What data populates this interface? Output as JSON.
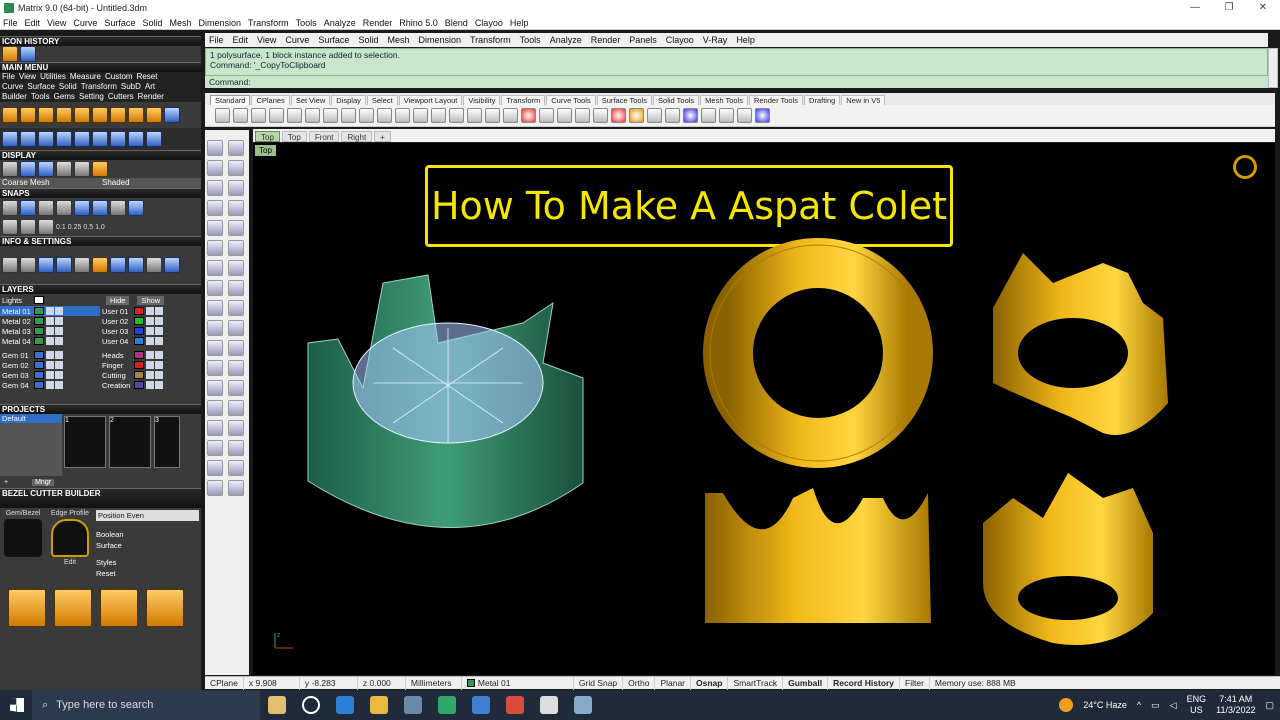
{
  "window": {
    "title": "Matrix 9.0 (64-bit) - Untitled.3dm",
    "controls": [
      "—",
      "❐",
      "✕"
    ]
  },
  "top_menu": [
    "File",
    "Edit",
    "View",
    "Curve",
    "Surface",
    "Solid",
    "Mesh",
    "Dimension",
    "Transform",
    "Tools",
    "Analyze",
    "Render",
    "Rhino 5.0",
    "Blend",
    "Clayoo",
    "Help"
  ],
  "left_panel": {
    "icon_history": "ICON HISTORY",
    "main_menu": "MAIN MENU",
    "main_menu_row1": [
      "File",
      "View",
      "Utilities",
      "Measure",
      "Custom",
      "Reset"
    ],
    "main_menu_row2": [
      "Curve",
      "Surface",
      "Solid",
      "Transform",
      "SubD",
      "Art"
    ],
    "main_menu_row3": [
      "Builder",
      "Tools",
      "Gems",
      "Setting",
      "Cutters",
      "Render"
    ],
    "display": "DISPLAY",
    "display_mode1": "Coarse Mesh",
    "display_mode2": "Shaded",
    "snaps": "SNAPS",
    "snap_values": [
      "0.1",
      "0.25",
      "0.5",
      "1.0"
    ],
    "info_settings": "INFO & SETTINGS",
    "layers": "LAYERS",
    "lights": "Lights",
    "hide": "Hide",
    "show": "Show",
    "layers_left": [
      {
        "name": "Metal 01",
        "color": "#2e9d4b"
      },
      {
        "name": "Metal 02",
        "color": "#2e9d4b"
      },
      {
        "name": "Metal 03",
        "color": "#2e9d4b"
      },
      {
        "name": "Metal 04",
        "color": "#2e9d4b"
      },
      {
        "name": "Gem 01",
        "color": "#3d6fd1"
      },
      {
        "name": "Gem 02",
        "color": "#3d6fd1"
      },
      {
        "name": "Gem 03",
        "color": "#3d6fd1"
      },
      {
        "name": "Gem 04",
        "color": "#3d6fd1"
      }
    ],
    "layers_right": [
      {
        "name": "User 01",
        "color": "#e02020"
      },
      {
        "name": "User 02",
        "color": "#20c020"
      },
      {
        "name": "User 03",
        "color": "#2040e0"
      },
      {
        "name": "User 04",
        "color": "#2080e0"
      },
      {
        "name": "Heads",
        "color": "#b03090"
      },
      {
        "name": "Finger",
        "color": "#d02020"
      },
      {
        "name": "Cutting",
        "color": "#b08040"
      },
      {
        "name": "Creation",
        "color": "#6040a0"
      }
    ],
    "projects": "PROJECTS",
    "projects_default": "Default",
    "project_thumbs": [
      "1",
      "2",
      "3"
    ],
    "mngr": "Mngr",
    "bezel_title": "BEZEL CUTTER BUILDER",
    "gem_bezel": "Gem/Bezel",
    "edge_profile": "Edge Profile",
    "edit": "Edit",
    "position_evenly": "Position Even",
    "boolean": "Boolean",
    "surface": "Surface",
    "styles": "Styles",
    "reset": "Reset"
  },
  "rhino_menu": [
    "File",
    "Edit",
    "View",
    "Curve",
    "Surface",
    "Solid",
    "Mesh",
    "Dimension",
    "Transform",
    "Tools",
    "Analyze",
    "Render",
    "Panels",
    "Clayoo",
    "V-Ray",
    "Help"
  ],
  "command": {
    "line1": "1 polysurface, 1 block instance added to selection.",
    "line2": "Command: '_CopyToClipboard",
    "prompt": "Command:"
  },
  "toolbar_tabs": [
    "Standard",
    "CPlanes",
    "Set View",
    "Display",
    "Select",
    "Viewport Layout",
    "Visibility",
    "Transform",
    "Curve Tools",
    "Surface Tools",
    "Solid Tools",
    "Mesh Tools",
    "Render Tools",
    "Drafting",
    "New in V5"
  ],
  "view_tabs": [
    "Top",
    "Top",
    "Front",
    "Right",
    "+"
  ],
  "viewport": {
    "label": "Top",
    "heading": "How To Make A Aspat Colet"
  },
  "status": {
    "cplane": "CPlane",
    "x": "x 9.908",
    "y": "y -8.283",
    "z": "z 0.000",
    "units": "Millimeters",
    "layer": "Metal 01",
    "items": [
      "Grid Snap",
      "Ortho",
      "Planar",
      "Osnap",
      "SmartTrack",
      "Gumball",
      "Record History",
      "Filter"
    ],
    "memory": "Memory use: 888 MB"
  },
  "taskbar": {
    "search_placeholder": "Type here to search",
    "weather": "24°C  Haze",
    "lang": "ENG",
    "region": "US",
    "time": "7:41 AM",
    "date": "11/3/2022"
  },
  "colors": {
    "accent_yellow": "#f5e600",
    "gold": "#d49b00",
    "green_collet": "#2e8b6a"
  }
}
